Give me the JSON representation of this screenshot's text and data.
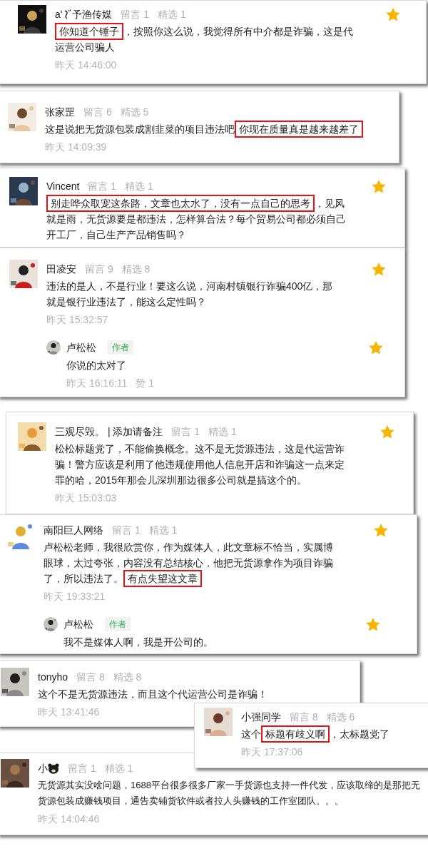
{
  "comments": [
    {
      "kind": "sign",
      "author_parts": [
        "a'",
        "予渔传媒"
      ],
      "stats": [
        "留言 1",
        "精选 1"
      ],
      "segments": [
        {
          "text": "你知道个锤子",
          "highlighted": true
        },
        {
          "text": "，按照你这么说，我觉得所有中介都是诈骗，这是代运营公司骗人",
          "highlighted": false
        }
      ],
      "time": "昨天 14:46:00",
      "starred": true
    },
    {
      "author": "张家罡",
      "stats": [
        "留言 6",
        "精选 5"
      ],
      "segments": [
        {
          "text": "这是说把无货源包装成割韭菜的项目违法吧",
          "highlighted": false
        },
        {
          "text": "你现在质量真是越来越差了",
          "highlighted": true
        }
      ],
      "time": "昨天 14:09:39",
      "starred": false
    },
    {
      "author": "Vincent",
      "stats": [
        "留言 1",
        "精选 1"
      ],
      "segments": [
        {
          "text": "别走哗众取宠这条路，文章也太水了，没有一点自己的思考",
          "highlighted": true
        },
        {
          "text": "，见风就是雨，无货源要是都违法，怎样算合法？每个贸易公司都必须自己开工厂，自己生产产品销售吗？",
          "highlighted": false
        }
      ],
      "starred": true
    },
    {
      "author": "田凌安",
      "stats": [
        "留言 9",
        "精选 8"
      ],
      "segments": [
        {
          "text": "违法的是人，不是行业！要这么说，河南村镇银行诈骗400亿，那就是银行业违法了，能这么定性吗？",
          "highlighted": false
        }
      ],
      "time": "昨天 15:32:57",
      "starred": true,
      "replies": [
        {
          "author": "卢松松",
          "badge": "作者",
          "text": "你说的太对了",
          "time": "昨天 16:16:11",
          "likes": "赞 1",
          "starred": true
        }
      ]
    },
    {
      "author": "三观尽毁。 | 添加请备注",
      "stats": [
        "留言 1",
        "精选 1"
      ],
      "segments": [
        {
          "text": "松松标题党了，不能偷换概念。这不是无货源违法，这是代运营诈骗！警方应该是利用了他违规使用他人信息开店和诈骗这一点来定罪的哈，2015年那会儿深圳那边很多公司就是搞这个的。",
          "highlighted": false
        }
      ],
      "time": "昨天 15:03:03",
      "starred": true
    },
    {
      "author": "南阳巨人网络",
      "stats": [
        "留言 1",
        "精选 1"
      ],
      "segments": [
        {
          "text": "卢松松老师，我很欣赏你，作为媒体人，此文章标不恰当，实属博眼球，太过夸张，内容没有总结核心，他把无货源拿作为项目诈骗了，所以违法了。",
          "highlighted": false
        },
        {
          "text": "有点失望这文章",
          "highlighted": true
        }
      ],
      "time": "昨天 19:33:21",
      "starred": true,
      "replies": [
        {
          "author": "卢松松",
          "badge": "作者",
          "text": "我不是媒体人啊，我是开公司的。",
          "starred": true
        }
      ]
    },
    {
      "author": "tonyho",
      "stats": [
        "留言 8",
        "精选 8"
      ],
      "segments": [
        {
          "text": "这个不是无货源违法，而且这个代运营公司是诈骗！",
          "highlighted": false
        }
      ],
      "time": "昨天 13:41:46",
      "starred": false
    },
    {
      "author": "小强同学",
      "stats": [
        "留言 8",
        "精选 6"
      ],
      "segments": [
        {
          "text": "这个",
          "highlighted": false
        },
        {
          "text": "标题有歧义啊",
          "highlighted": true
        },
        {
          "text": "，太标题党了",
          "highlighted": false
        }
      ],
      "time": "昨天 17:37:06",
      "starred": false
    },
    {
      "kind": "bear",
      "author": "小",
      "stats": [
        "留言 1",
        "精选 1"
      ],
      "segments": [
        {
          "text": "无货源其实没啥问题，1688平台很多很多厂家一手货源也支持一件代发，应该取缔的是那把无货源包装成赚钱项目，通告卖铺货软件或者拉人头赚钱的工作室团队。。。",
          "highlighted": false
        }
      ],
      "time": "昨天 14:04:46",
      "starred": false
    }
  ]
}
